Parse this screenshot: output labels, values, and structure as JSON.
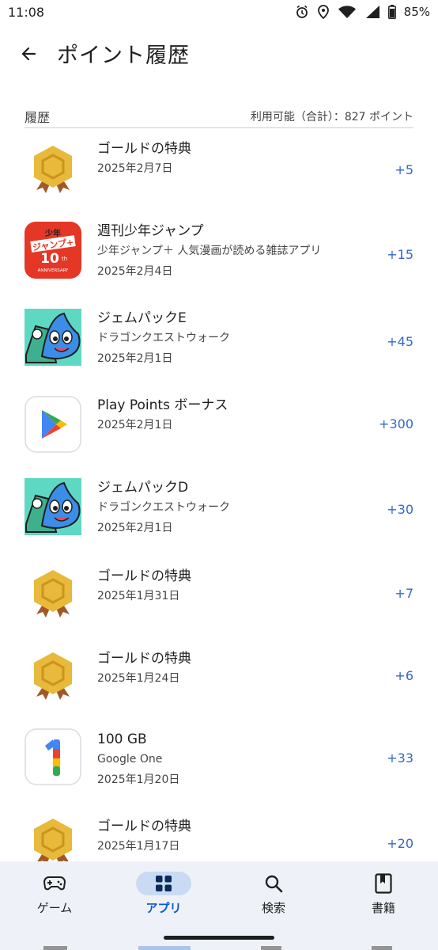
{
  "status": {
    "time": "11:08",
    "battery": "85%"
  },
  "header": {
    "title": "ポイント履歴"
  },
  "section": {
    "label": "履歴",
    "available": "利用可能（合計）：827 ポイント"
  },
  "items": [
    {
      "icon": "gold-medal",
      "title": "ゴールドの特典",
      "subtitle": "",
      "date": "2025年2月7日",
      "points": "+5"
    },
    {
      "icon": "shonen-jump-app",
      "icon_text_top": "少年",
      "icon_text_mid": "ジャンプ+",
      "icon_text_big": "10",
      "icon_text_small": "th",
      "icon_text_ann": "ANNIVERSARY",
      "title": "週刊少年ジャンプ",
      "subtitle": "少年ジャンプ＋ 人気漫画が読める雑誌アプリ",
      "date": "2025年2月4日",
      "points": "+15"
    },
    {
      "icon": "dragon-quest-walk",
      "title": "ジェムパックE",
      "subtitle": "ドラゴンクエストウォーク",
      "date": "2025年2月1日",
      "points": "+45"
    },
    {
      "icon": "google-play",
      "title": "Play Points ボーナス",
      "subtitle": "",
      "date": "2025年2月1日",
      "points": "+300"
    },
    {
      "icon": "dragon-quest-walk",
      "title": "ジェムパックD",
      "subtitle": "ドラゴンクエストウォーク",
      "date": "2025年2月1日",
      "points": "+30"
    },
    {
      "icon": "gold-medal",
      "title": "ゴールドの特典",
      "subtitle": "",
      "date": "2025年1月31日",
      "points": "+7"
    },
    {
      "icon": "gold-medal",
      "title": "ゴールドの特典",
      "subtitle": "",
      "date": "2025年1月24日",
      "points": "+6"
    },
    {
      "icon": "google-one",
      "title": "100 GB",
      "subtitle": "Google One",
      "date": "2025年1月20日",
      "points": "+33"
    },
    {
      "icon": "gold-medal",
      "title": "ゴールドの特典",
      "subtitle": "",
      "date": "2025年1月17日",
      "points": "+20"
    }
  ],
  "nav": [
    {
      "icon": "gamepad-icon",
      "label": "ゲーム",
      "active": false
    },
    {
      "icon": "apps-grid-icon",
      "label": "アプリ",
      "active": true
    },
    {
      "icon": "search-icon",
      "label": "検索",
      "active": false
    },
    {
      "icon": "bookmark-book-icon",
      "label": "書籍",
      "active": false
    }
  ],
  "colors": {
    "accent": "#0b57d0",
    "points": "#3366cc",
    "nav_bg": "#eef2f8",
    "gold": "#e8b93a",
    "ribbon": "#a0582a"
  }
}
